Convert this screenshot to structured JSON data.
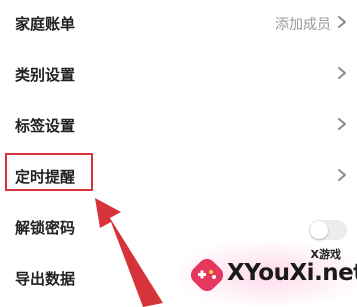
{
  "settings": {
    "rows": [
      {
        "label": "家庭账单",
        "value": "添加成员"
      },
      {
        "label": "类别设置"
      },
      {
        "label": "标签设置"
      },
      {
        "label": "定时提醒"
      },
      {
        "label": "解锁密码",
        "toggle_on": false
      },
      {
        "label": "导出数据"
      }
    ]
  },
  "annotation": {
    "color": "#d6343a"
  },
  "watermark": {
    "badge": "X游戏",
    "site": "XYouXi.net"
  }
}
